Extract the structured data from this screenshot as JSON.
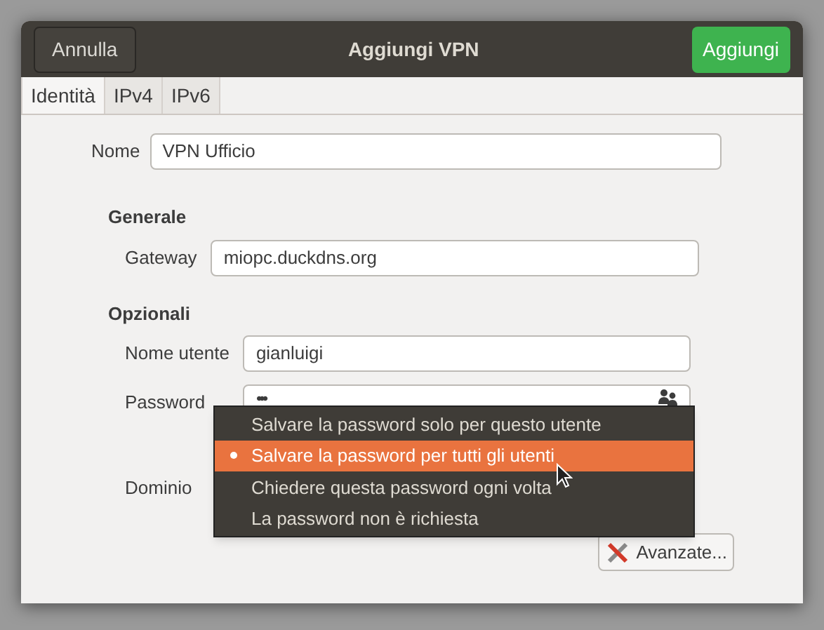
{
  "dialog": {
    "title": "Aggiungi VPN",
    "cancel_button": "Annulla",
    "confirm_button": "Aggiungi"
  },
  "tabs": [
    {
      "label": "Identità",
      "selected": true
    },
    {
      "label": "IPv4",
      "selected": false
    },
    {
      "label": "IPv6",
      "selected": false
    }
  ],
  "name_field": {
    "label": "Nome",
    "value": "VPN Ufficio"
  },
  "sections": [
    {
      "title": "Generale",
      "fields": [
        {
          "label": "Gateway",
          "value": "miopc.duckdns.org"
        }
      ]
    },
    {
      "title": "Opzionali",
      "fields": [
        {
          "label": "Nome utente",
          "value": "gianluigi"
        },
        {
          "label": "Password",
          "value": "•••",
          "kind": "password"
        },
        {
          "label": "Dominio"
        }
      ]
    }
  ],
  "password_menu": [
    {
      "label": "Salvare la password solo per questo utente",
      "selected": false,
      "highlighted": false
    },
    {
      "label": "Salvare la password per tutti gli utenti",
      "selected": true,
      "highlighted": true
    },
    {
      "label": "Chiedere questa password ogni volta",
      "selected": false,
      "highlighted": false
    },
    {
      "label": "La password non è richiesta",
      "selected": false,
      "highlighted": false
    }
  ],
  "advanced_button": "Avanzate..."
}
